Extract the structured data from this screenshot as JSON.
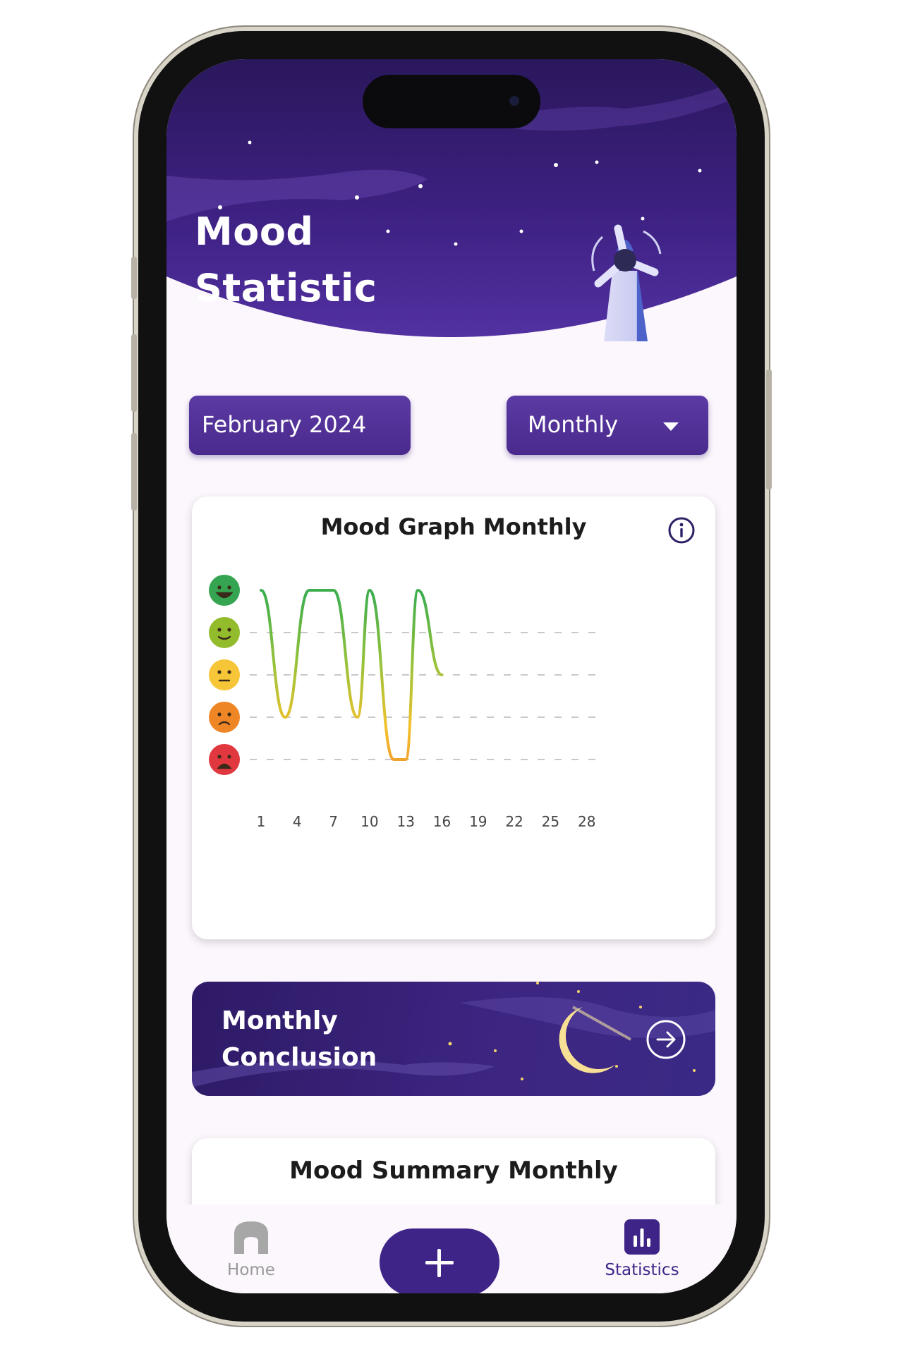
{
  "header": {
    "title_line1": "Mood",
    "title_line2": "Statistic"
  },
  "controls": {
    "date_label": "February 2024",
    "period_label": "Monthly"
  },
  "graph": {
    "title": "Mood Graph Monthly",
    "x_ticks": [
      "1",
      "4",
      "7",
      "10",
      "13",
      "16",
      "19",
      "22",
      "25",
      "28"
    ]
  },
  "chart_data": {
    "type": "line",
    "x": [
      1,
      3,
      5,
      7,
      9,
      10,
      12,
      13,
      14,
      16
    ],
    "values": [
      5,
      2,
      5,
      5,
      2,
      5,
      1,
      1,
      5,
      3
    ],
    "xticks": [
      1,
      4,
      7,
      10,
      13,
      16,
      19,
      22,
      25,
      28
    ],
    "y_levels": [
      "angry",
      "sad",
      "neutral",
      "happy",
      "very happy"
    ],
    "ylim": [
      1,
      5
    ]
  },
  "conclusion": {
    "line1": "Monthly",
    "line2": "Conclusion"
  },
  "summary": {
    "title": "Mood Summary Monthly"
  },
  "nav": {
    "home": "Home",
    "statistics": "Statistics"
  },
  "colors": {
    "primary": "#3f2488",
    "accent_purple": "#4a2a8d",
    "inactive": "#9a9a9a"
  }
}
